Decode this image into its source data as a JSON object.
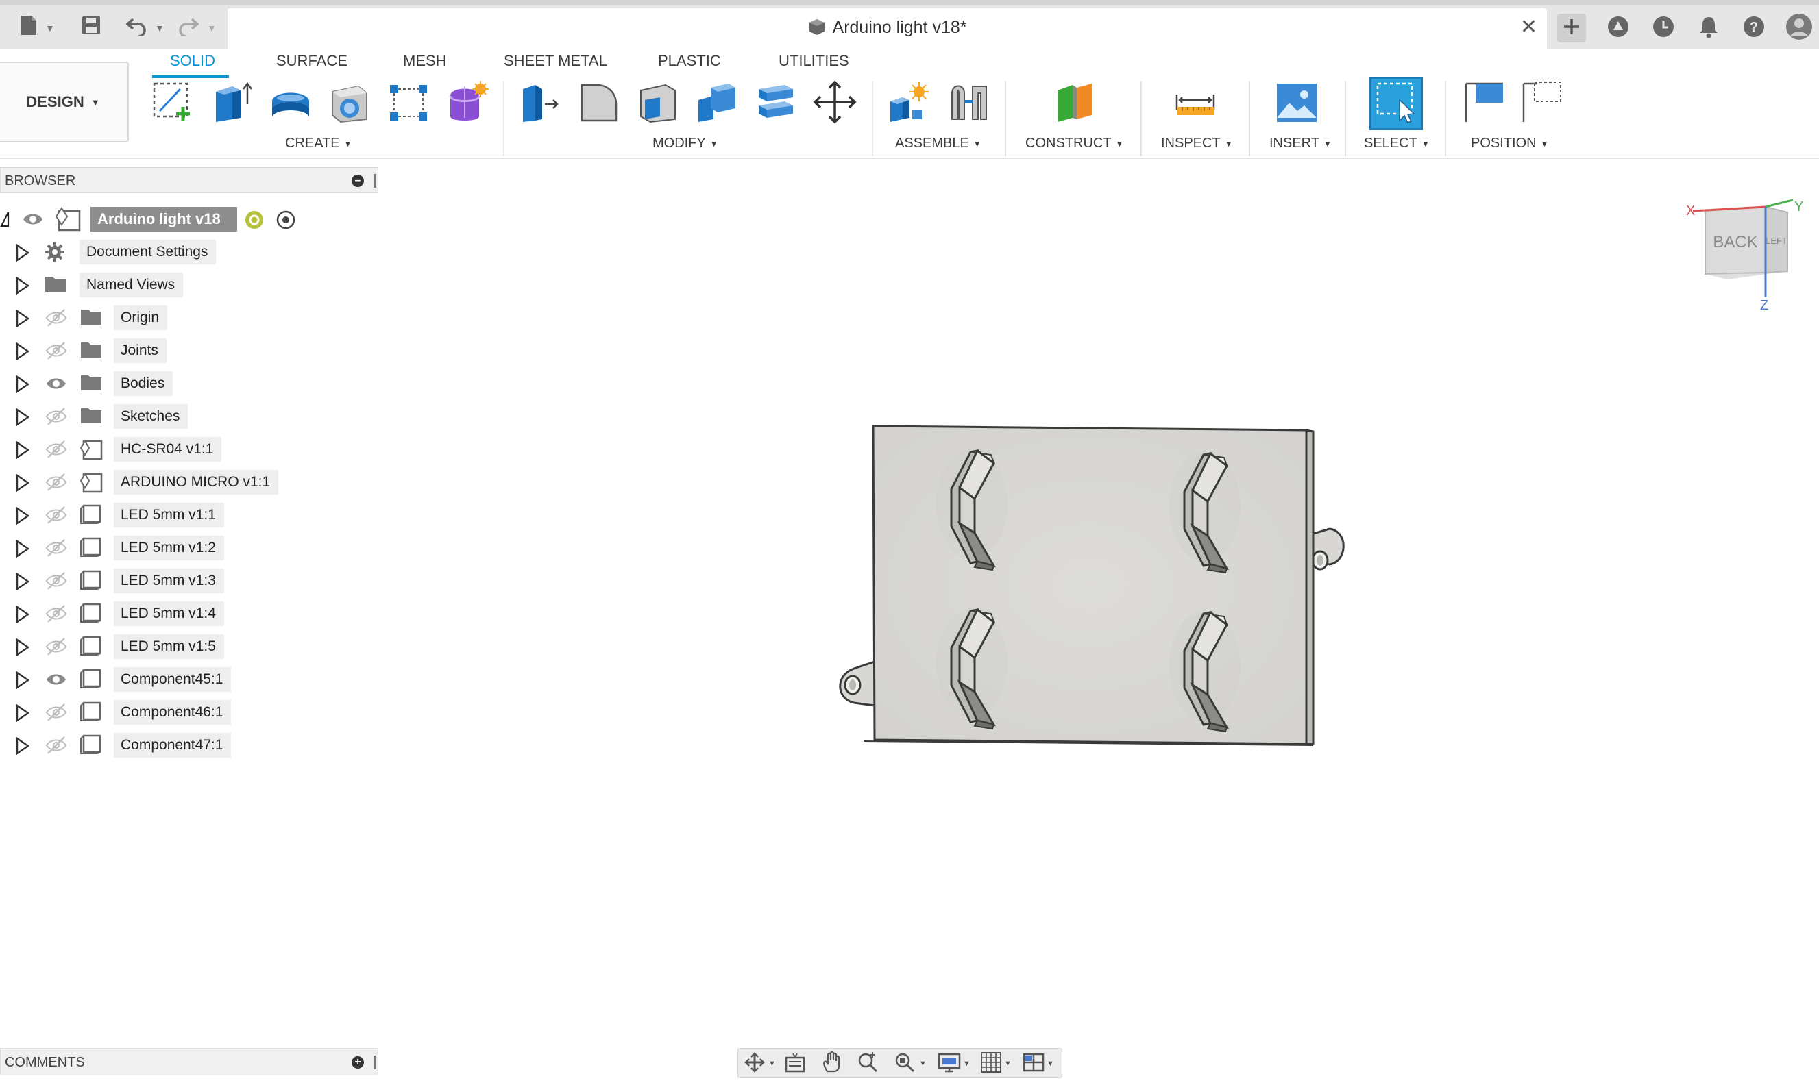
{
  "window": {
    "document_title": "Arduino light v18*"
  },
  "workspace": {
    "label": "DESIGN"
  },
  "ribbon": {
    "tabs": [
      "SOLID",
      "SURFACE",
      "MESH",
      "SHEET METAL",
      "PLASTIC",
      "UTILITIES"
    ],
    "active_tab": "SOLID",
    "groups": {
      "create": "CREATE",
      "modify": "MODIFY",
      "assemble": "ASSEMBLE",
      "construct": "CONSTRUCT",
      "inspect": "INSPECT",
      "insert": "INSERT",
      "select": "SELECT",
      "position": "POSITION"
    }
  },
  "browser": {
    "title": "BROWSER",
    "root": "Arduino light v18",
    "items": [
      {
        "label": "Document Settings",
        "icon": "gear-icon",
        "visible": null
      },
      {
        "label": "Named Views",
        "icon": "folder-icon",
        "visible": null
      },
      {
        "label": "Origin",
        "icon": "folder-icon",
        "visible": false
      },
      {
        "label": "Joints",
        "icon": "folder-icon",
        "visible": false
      },
      {
        "label": "Bodies",
        "icon": "folder-icon",
        "visible": true
      },
      {
        "label": "Sketches",
        "icon": "folder-icon",
        "visible": false
      },
      {
        "label": "HC-SR04 v1:1",
        "icon": "linked-component-icon",
        "visible": false
      },
      {
        "label": "ARDUINO MICRO v1:1",
        "icon": "linked-component-icon",
        "visible": false
      },
      {
        "label": "LED 5mm v1:1",
        "icon": "component-icon",
        "visible": false
      },
      {
        "label": "LED 5mm v1:2",
        "icon": "component-icon",
        "visible": false
      },
      {
        "label": "LED 5mm v1:3",
        "icon": "component-icon",
        "visible": false
      },
      {
        "label": "LED 5mm v1:4",
        "icon": "component-icon",
        "visible": false
      },
      {
        "label": "LED 5mm v1:5",
        "icon": "component-icon",
        "visible": false
      },
      {
        "label": "Component45:1",
        "icon": "component-icon",
        "visible": true
      },
      {
        "label": "Component46:1",
        "icon": "component-icon",
        "visible": false
      },
      {
        "label": "Component47:1",
        "icon": "component-icon",
        "visible": false
      }
    ]
  },
  "comments": {
    "title": "COMMENTS"
  },
  "viewcube": {
    "face_front": "BACK",
    "face_side": "LEFT",
    "axis_x": "X",
    "axis_y": "Y",
    "axis_z": "Z"
  },
  "colors": {
    "accent": "#0696d7",
    "selection_fill": "#2aa1dd",
    "model_face": "#d9d8d4"
  }
}
